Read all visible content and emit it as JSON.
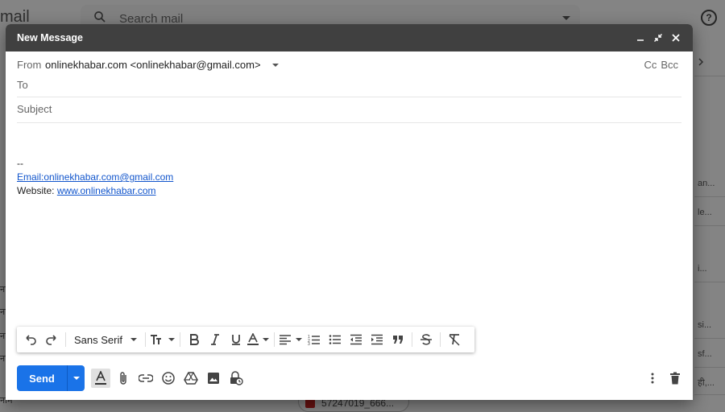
{
  "background": {
    "brand_fragment": "mail",
    "search_placeholder": "Search mail",
    "help_glyph": "?",
    "left_lines": [
      "ना",
      "ना",
      "ना",
      "ना",
      "नाम"
    ],
    "right_lines": [
      "",
      "",
      "",
      "an...",
      "le...",
      "",
      "i...",
      "",
      "si...",
      "sf...",
      "ही,..."
    ],
    "attachment_chip": "57247019_666..."
  },
  "compose": {
    "title": "New Message",
    "header_icons": [
      "minimize-icon",
      "expand-icon",
      "close-icon"
    ],
    "from_label": "From",
    "from_value": "onlinekhabar.com <onlinekhabar@gmail.com>",
    "cc_label": "Cc",
    "bcc_label": "Bcc",
    "to_placeholder": "To",
    "subject_placeholder": "Subject",
    "body": {
      "separator": "--",
      "email_link": "Email:onlinekhabar.com@gmail.com",
      "website_label": "Website: ",
      "website_link": "www.onlinekhabar.com"
    },
    "toolbar": {
      "font": "Sans Serif",
      "icons": [
        "undo-icon",
        "redo-icon",
        "font-select",
        "text-size-icon",
        "bold-icon",
        "italic-icon",
        "underline-icon",
        "text-color-icon",
        "align-icon",
        "numbered-list-icon",
        "bulleted-list-icon",
        "indent-less-icon",
        "indent-more-icon",
        "quote-icon",
        "strikethrough-icon",
        "remove-formatting-icon"
      ]
    },
    "send_label": "Send",
    "bottom_icons": [
      "formatting-options-icon",
      "attach-icon",
      "link-icon",
      "emoji-icon",
      "drive-icon",
      "photo-icon",
      "confidential-icon",
      "more-options-icon",
      "discard-icon"
    ]
  },
  "colors": {
    "header": "#404040",
    "send": "#1a73e8",
    "link": "#1155cc"
  }
}
